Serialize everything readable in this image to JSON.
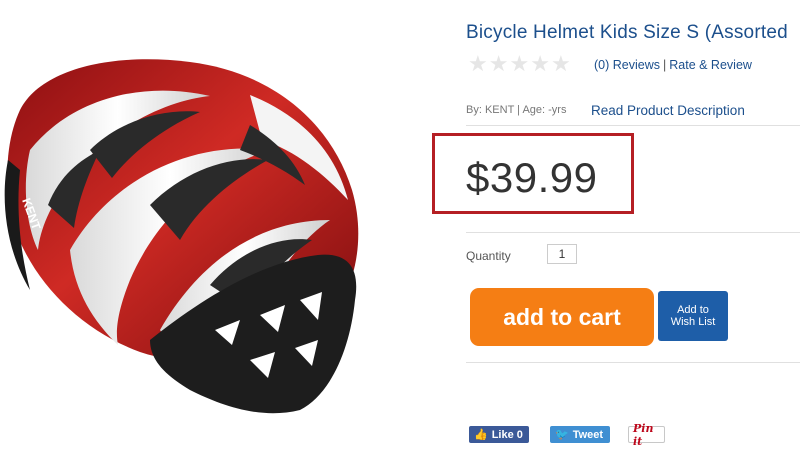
{
  "product": {
    "title": "Bicycle Helmet Kids Size S (Assorted",
    "rating": 0,
    "reviews_link": "(0) Reviews",
    "reviews_sep": "|",
    "rate_link": "Rate & Review",
    "by_line": "By: KENT | Age: -yrs",
    "read_desc": "Read Product Description",
    "price": "$39.99",
    "quantity_label": "Quantity",
    "quantity_value": "1",
    "add_to_cart": "add to cart",
    "wishlist_line1": "Add to",
    "wishlist_line2": "Wish List",
    "helmet_brand_text": "KENT"
  },
  "social": {
    "like": "Like 0",
    "tweet": "Tweet",
    "pin": "Pin it"
  },
  "colors": {
    "link": "#1c4f8c",
    "price_highlight": "#b51f24",
    "cart_button": "#f57e14",
    "wishlist_button": "#1e5ea8",
    "helmet_red": "#b71c1c",
    "helmet_white": "#f2f2f2"
  }
}
